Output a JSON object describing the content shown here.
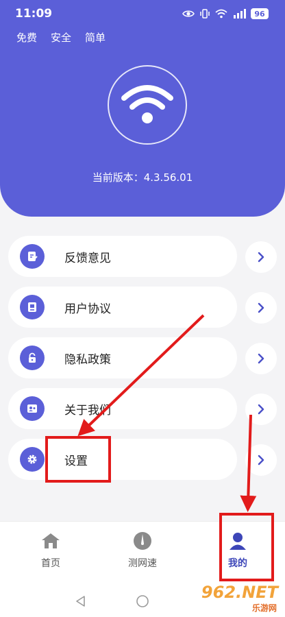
{
  "status_bar": {
    "time": "11:09",
    "battery": "96",
    "icons": [
      "eye-icon",
      "vibrate-icon",
      "wifi-icon",
      "signal-icon",
      "battery-icon"
    ]
  },
  "header": {
    "tags": [
      "免费",
      "安全",
      "简单"
    ],
    "version_label": "当前版本：4.3.56.01",
    "logo_icon": "wifi-icon",
    "color": "#5b5fd8"
  },
  "menu": {
    "items": [
      {
        "label": "反馈意见",
        "icon": "feedback-icon"
      },
      {
        "label": "用户协议",
        "icon": "agreement-icon"
      },
      {
        "label": "隐私政策",
        "icon": "lock-icon"
      },
      {
        "label": "关于我们",
        "icon": "about-icon"
      },
      {
        "label": "设置",
        "icon": "gear-icon"
      }
    ]
  },
  "tabbar": {
    "tabs": [
      {
        "label": "首页",
        "icon": "home-icon",
        "active": false
      },
      {
        "label": "测网速",
        "icon": "speed-gauge-icon",
        "active": false
      },
      {
        "label": "我的",
        "icon": "user-icon",
        "active": true
      }
    ],
    "active_color": "#3d46b8"
  },
  "watermark": {
    "text": "962.NET",
    "sub": "乐游网"
  },
  "annotation_color": "#e21b1b"
}
